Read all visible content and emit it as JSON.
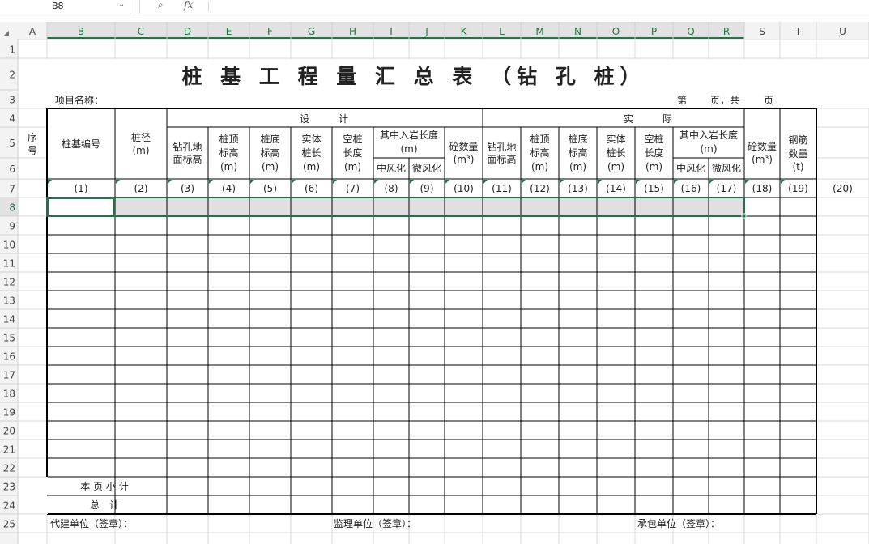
{
  "formula_bar": {
    "cell_ref": "B8",
    "fx_label": "fx",
    "formula": ""
  },
  "columns": [
    "A",
    "B",
    "C",
    "D",
    "E",
    "F",
    "G",
    "H",
    "I",
    "J",
    "K",
    "L",
    "M",
    "N",
    "O",
    "P",
    "Q",
    "R",
    "S",
    "T",
    "U"
  ],
  "rows": [
    "1",
    "2",
    "3",
    "4",
    "5",
    "6",
    "7",
    "8",
    "9",
    "10",
    "11",
    "12",
    "13",
    "14",
    "15",
    "16",
    "17",
    "18",
    "19",
    "20",
    "21",
    "22",
    "23",
    "24",
    "25"
  ],
  "sheet": {
    "title": "桩 基 工 程 量 汇 总 表 （钻 孔 桩）",
    "project_label": "项目名称：",
    "page_label_1": "第",
    "page_label_2": "页，共",
    "page_label_3": "页",
    "design_header": "设　　　计",
    "actual_header": "实　　　际",
    "col_seq": [
      "序",
      "号"
    ],
    "col_pile_no": "桩基编号",
    "col_diameter": [
      "桩径",
      "(m)"
    ],
    "design_cols": {
      "ground_elev": [
        "钻孔地",
        "面标高"
      ],
      "top_elev": [
        "桩顶",
        "标高",
        "(m)"
      ],
      "bottom_elev": [
        "桩底",
        "标高",
        "(m)"
      ],
      "solid_len": [
        "实体",
        "桩长",
        "(m)"
      ],
      "empty_len": [
        "空桩",
        "长度",
        "(m)"
      ],
      "rock_depth": [
        "其中入岩长度",
        "(m)"
      ],
      "mid_weathered": "中风化",
      "slight_weathered": "微风化",
      "concrete": [
        "砼数量",
        "(m³)"
      ]
    },
    "actual_cols": {
      "ground_elev": [
        "钻孔地",
        "面标高"
      ],
      "top_elev": [
        "桩顶",
        "标高",
        "(m)"
      ],
      "bottom_elev": [
        "桩底",
        "标高",
        "(m)"
      ],
      "solid_len": [
        "实体",
        "桩长",
        "(m)"
      ],
      "empty_len": [
        "空桩",
        "长度",
        "(m)"
      ],
      "rock_depth": [
        "其中入岩长度",
        "(m)"
      ],
      "mid_weathered": "中风化",
      "slight_weathered": "微风化",
      "concrete": [
        "砼数量",
        "(m³)"
      ],
      "rebar": [
        "钢筋",
        "数量",
        "(t)"
      ]
    },
    "col_numbers": [
      "(1)",
      "(2)",
      "(3)",
      "(4)",
      "(5)",
      "(6)",
      "(7)",
      "(8)",
      "(9)",
      "(10)",
      "(11)",
      "(12)",
      "(13)",
      "(14)",
      "(15)",
      "(16)",
      "(17)",
      "(18)",
      "(19)",
      "(20)"
    ],
    "page_subtotal": "本 页 小 计",
    "grand_total": "总　计",
    "sign_agent": "代建单位（签章）：",
    "sign_supervisor": "监理单位（签章）：",
    "sign_contractor": "承包单位（签章）："
  },
  "colors": {
    "accent": "#217346",
    "header_bg": "#f3f3f3",
    "grid": "#d9d9d9",
    "selection_fill": "#e0e0e0"
  }
}
